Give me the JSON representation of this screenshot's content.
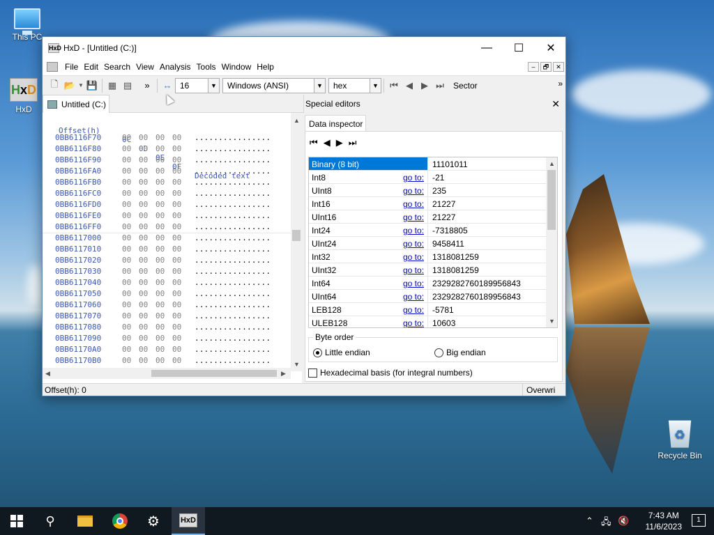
{
  "desktop": {
    "icons": [
      {
        "label": "This PC"
      },
      {
        "label": "HxD"
      },
      {
        "label": "Recycle Bin"
      }
    ]
  },
  "window": {
    "title": "HxD - [Untitled (C:)]",
    "controls": {
      "minimize": "—",
      "maximize": "☐",
      "close": "✕"
    },
    "menu": [
      "File",
      "Edit",
      "Search",
      "View",
      "Analysis",
      "Tools",
      "Window",
      "Help"
    ],
    "mdi_controls": [
      "–",
      "🗗",
      "✕"
    ],
    "toolbar": {
      "bytes_per_row": "16",
      "charset": "Windows (ANSI)",
      "base": "hex",
      "nav_label": "Sector",
      "overflow": "»"
    },
    "tab": "Untitled (C:)",
    "special_editors": {
      "title": "Special editors",
      "close": "✕",
      "tab": "Data inspector",
      "nav": [
        "⏮",
        "◀",
        "▶",
        "⏭"
      ],
      "rows": [
        {
          "name": "Binary (8 bit)",
          "goto": "",
          "value": "11101011",
          "selected": true
        },
        {
          "name": "Int8",
          "goto": "go to:",
          "value": "-21"
        },
        {
          "name": "UInt8",
          "goto": "go to:",
          "value": "235"
        },
        {
          "name": "Int16",
          "goto": "go to:",
          "value": "21227"
        },
        {
          "name": "UInt16",
          "goto": "go to:",
          "value": "21227"
        },
        {
          "name": "Int24",
          "goto": "go to:",
          "value": "-7318805"
        },
        {
          "name": "UInt24",
          "goto": "go to:",
          "value": "9458411"
        },
        {
          "name": "Int32",
          "goto": "go to:",
          "value": "1318081259"
        },
        {
          "name": "UInt32",
          "goto": "go to:",
          "value": "1318081259"
        },
        {
          "name": "Int64",
          "goto": "go to:",
          "value": "2329282760189956843"
        },
        {
          "name": "UInt64",
          "goto": "go to:",
          "value": "2329282760189956843"
        },
        {
          "name": "LEB128",
          "goto": "go to:",
          "value": "-5781"
        },
        {
          "name": "ULEB128",
          "goto": "go to:",
          "value": "10603"
        }
      ],
      "byte_order": {
        "legend": "Byte order",
        "little": "Little endian",
        "big": "Big endian",
        "selected": "little"
      },
      "hex_basis": {
        "label": "Hexadecimal basis (for integral numbers)",
        "checked": false
      }
    },
    "hex_view": {
      "header": {
        "offset": "Offset(h)",
        "columns": [
          "0C",
          "0D",
          "0E",
          "0F"
        ],
        "decoded": "Decoded text"
      },
      "rows": [
        {
          "offset": "0BB6116F70",
          "bytes": [
            "00",
            "00",
            "00",
            "00"
          ],
          "text": "................"
        },
        {
          "offset": "0BB6116F80",
          "bytes": [
            "00",
            "00",
            "00",
            "00"
          ],
          "text": "................"
        },
        {
          "offset": "0BB6116F90",
          "bytes": [
            "00",
            "00",
            "00",
            "00"
          ],
          "text": "................"
        },
        {
          "offset": "0BB6116FA0",
          "bytes": [
            "00",
            "00",
            "00",
            "00"
          ],
          "text": "................"
        },
        {
          "offset": "0BB6116FB0",
          "bytes": [
            "00",
            "00",
            "00",
            "00"
          ],
          "text": "................"
        },
        {
          "offset": "0BB6116FC0",
          "bytes": [
            "00",
            "00",
            "00",
            "00"
          ],
          "text": "................"
        },
        {
          "offset": "0BB6116FD0",
          "bytes": [
            "00",
            "00",
            "00",
            "00"
          ],
          "text": "................"
        },
        {
          "offset": "0BB6116FE0",
          "bytes": [
            "00",
            "00",
            "00",
            "00"
          ],
          "text": "................"
        },
        {
          "offset": "0BB6116FF0",
          "bytes": [
            "00",
            "00",
            "00",
            "00"
          ],
          "text": "................"
        },
        {
          "offset": "0BB6117000",
          "bytes": [
            "00",
            "00",
            "00",
            "00"
          ],
          "text": "................"
        },
        {
          "offset": "0BB6117010",
          "bytes": [
            "00",
            "00",
            "00",
            "00"
          ],
          "text": "................"
        },
        {
          "offset": "0BB6117020",
          "bytes": [
            "00",
            "00",
            "00",
            "00"
          ],
          "text": "................"
        },
        {
          "offset": "0BB6117030",
          "bytes": [
            "00",
            "00",
            "00",
            "00"
          ],
          "text": "................"
        },
        {
          "offset": "0BB6117040",
          "bytes": [
            "00",
            "00",
            "00",
            "00"
          ],
          "text": "................"
        },
        {
          "offset": "0BB6117050",
          "bytes": [
            "00",
            "00",
            "00",
            "00"
          ],
          "text": "................"
        },
        {
          "offset": "0BB6117060",
          "bytes": [
            "00",
            "00",
            "00",
            "00"
          ],
          "text": "................"
        },
        {
          "offset": "0BB6117070",
          "bytes": [
            "00",
            "00",
            "00",
            "00"
          ],
          "text": "................"
        },
        {
          "offset": "0BB6117080",
          "bytes": [
            "00",
            "00",
            "00",
            "00"
          ],
          "text": "................"
        },
        {
          "offset": "0BB6117090",
          "bytes": [
            "00",
            "00",
            "00",
            "00"
          ],
          "text": "................"
        },
        {
          "offset": "0BB61170A0",
          "bytes": [
            "00",
            "00",
            "00",
            "00"
          ],
          "text": "................"
        },
        {
          "offset": "0BB61170B0",
          "bytes": [
            "00",
            "00",
            "00",
            "00"
          ],
          "text": "................"
        }
      ]
    },
    "status": {
      "offset": "Offset(h): 0",
      "mode": "Overwri"
    }
  },
  "taskbar": {
    "time": "7:43 AM",
    "date": "11/6/2023",
    "notification_count": "1"
  }
}
